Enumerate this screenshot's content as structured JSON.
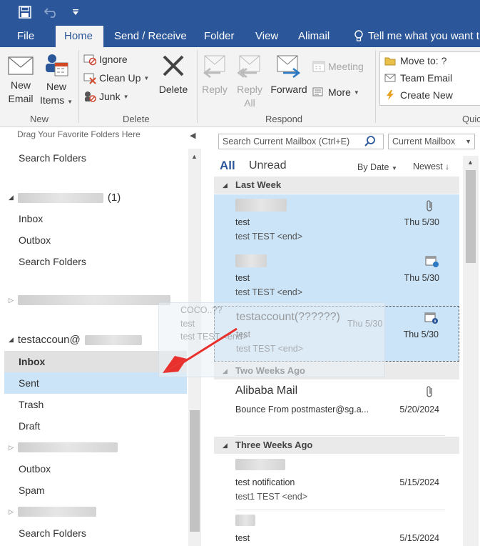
{
  "ribbon_tabs": [
    "File",
    "Home",
    "Send / Receive",
    "Folder",
    "View",
    "Alimail",
    "Tell me what you want t"
  ],
  "ribbon": {
    "new_email": [
      "New",
      "Email"
    ],
    "new_items": [
      "New",
      "Items"
    ],
    "group_new": "New",
    "ignore": "Ignore",
    "clean_up": "Clean Up",
    "junk": "Junk",
    "delete": "Delete",
    "group_delete": "Delete",
    "reply": "Reply",
    "reply_all": [
      "Reply",
      "All"
    ],
    "forward": "Forward",
    "meeting": "Meeting",
    "more": "More",
    "group_respond": "Respond",
    "quick_steps": [
      "Move to: ?",
      "Team Email",
      "Create New"
    ],
    "group_quick": "Quic"
  },
  "folders": {
    "favorites_hint": "Drag Your Favorite Folders Here",
    "fav_search": "Search Folders",
    "account1_count": "(1)",
    "account1_items": [
      "Inbox",
      "Outbox",
      "Search Folders"
    ],
    "account3_name": "testaccoun@",
    "account3_items": [
      "Inbox",
      "Sent",
      "Trash",
      "Draft"
    ],
    "account3_more": [
      "Outbox",
      "Spam"
    ],
    "last_search": "Search Folders"
  },
  "list": {
    "search_placeholder": "Search Current Mailbox (Ctrl+E)",
    "scope": "Current Mailbox",
    "filter_all": "All",
    "filter_unread": "Unread",
    "sort_by": "By Date",
    "sort_order": "Newest",
    "groups": [
      "Last Week",
      "Two Weeks Ago",
      "Three Weeks Ago"
    ],
    "messages": [
      {
        "from": "",
        "subject": "test",
        "preview": "test  TEST <end>",
        "date": "Thu 5/30"
      },
      {
        "from": "",
        "subject": "test",
        "preview": "test  TEST <end>",
        "date": "Thu 5/30"
      },
      {
        "from": "testaccount(??????)",
        "subject": "test",
        "preview": "test  TEST <end>",
        "date": "Thu 5/30"
      },
      {
        "from": "Alibaba Mail",
        "subject": "Bounce From postmaster@sg.a...",
        "preview": "",
        "date": "5/20/2024"
      },
      {
        "from": "",
        "subject": "test notification",
        "preview": "test1  TEST <end>",
        "date": "5/15/2024"
      },
      {
        "from": "",
        "subject": "test",
        "preview": "",
        "date": "5/15/2024"
      }
    ]
  },
  "drag_ghost": {
    "from": "COCO..??",
    "subject": "test",
    "preview": "test  TEST <end>",
    "date": "Thu 5/30"
  },
  "colors": {
    "accent": "#2b579a",
    "selection": "#cce4f7",
    "arrow": "#e8302c"
  }
}
